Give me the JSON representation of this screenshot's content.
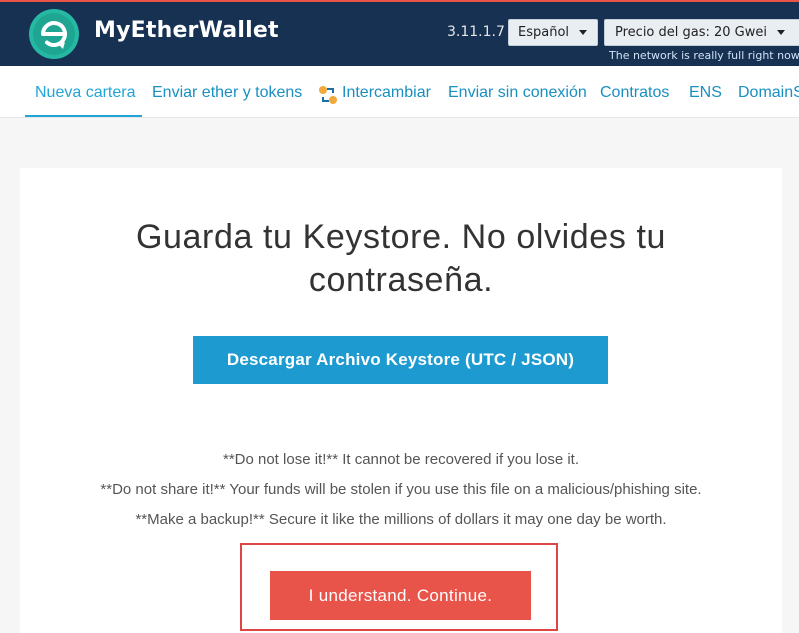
{
  "header": {
    "brand": "MyEtherWallet",
    "version": "3.11.1.7",
    "language": "Español",
    "gas_price": "Precio del gas: 20 Gwei",
    "gas_note": "The network is really full right now. C",
    "colors": {
      "topbar": "#163151",
      "accent": "#e8534a"
    },
    "logo_icon": "mew-logo-icon"
  },
  "nav": {
    "items": [
      {
        "label": "Nueva cartera",
        "active": true
      },
      {
        "label": "Enviar ether y tokens"
      },
      {
        "label": "Intercambiar",
        "icon": "swap-icon"
      },
      {
        "label": "Enviar sin conexión"
      },
      {
        "label": "Contratos"
      },
      {
        "label": "ENS"
      },
      {
        "label": "DomainS"
      }
    ]
  },
  "main": {
    "title_line1": "Guarda tu Keystore. No olvides tu",
    "title_line2": "contraseña.",
    "download_button": "Descargar Archivo Keystore (UTC / JSON)",
    "warnings": [
      "**Do not lose it!** It cannot be recovered if you lose it.",
      "**Do not share it!** Your funds will be stolen if you use this file on a malicious/phishing site.",
      "**Make a backup!** Secure it like the millions of dollars it may one day be worth."
    ],
    "continue_button": "I understand. Continue.",
    "colors": {
      "download": "#1d9bd1",
      "continue": "#e8534a",
      "highlight_frame": "#e04545"
    }
  }
}
